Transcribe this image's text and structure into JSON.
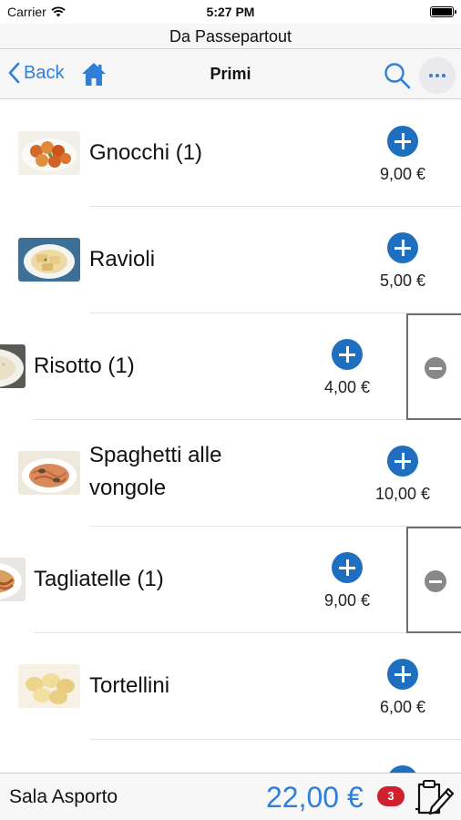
{
  "status": {
    "carrier": "Carrier",
    "time": "5:27 PM",
    "battery_level": 1.0
  },
  "app_title": "Da Passepartout",
  "nav": {
    "back_label": "Back",
    "title": "Primi"
  },
  "items": [
    {
      "name": "Gnocchi (1)",
      "price": "9,00 €",
      "thumb": "gnocchi-photo",
      "removable": false
    },
    {
      "name": "Ravioli",
      "price": "5,00 €",
      "thumb": "ravioli-photo",
      "removable": false
    },
    {
      "name": "Risotto (1)",
      "price": "4,00 €",
      "thumb": "risotto-photo",
      "removable": true
    },
    {
      "name": "Spaghetti alle vongole",
      "price": "10,00 €",
      "thumb": "spaghetti-photo",
      "removable": false
    },
    {
      "name": "Tagliatelle (1)",
      "price": "9,00 €",
      "thumb": "tagliatelle-photo",
      "removable": true
    },
    {
      "name": "Tortellini",
      "price": "6,00 €",
      "thumb": "tortellini-photo",
      "removable": false
    }
  ],
  "footer": {
    "room": "Sala Asporto",
    "total": "22,00 €",
    "badge_count": "3"
  },
  "colors": {
    "accent": "#2f7ed8",
    "add_button": "#1e6fbf",
    "badge": "#d01f2f"
  }
}
